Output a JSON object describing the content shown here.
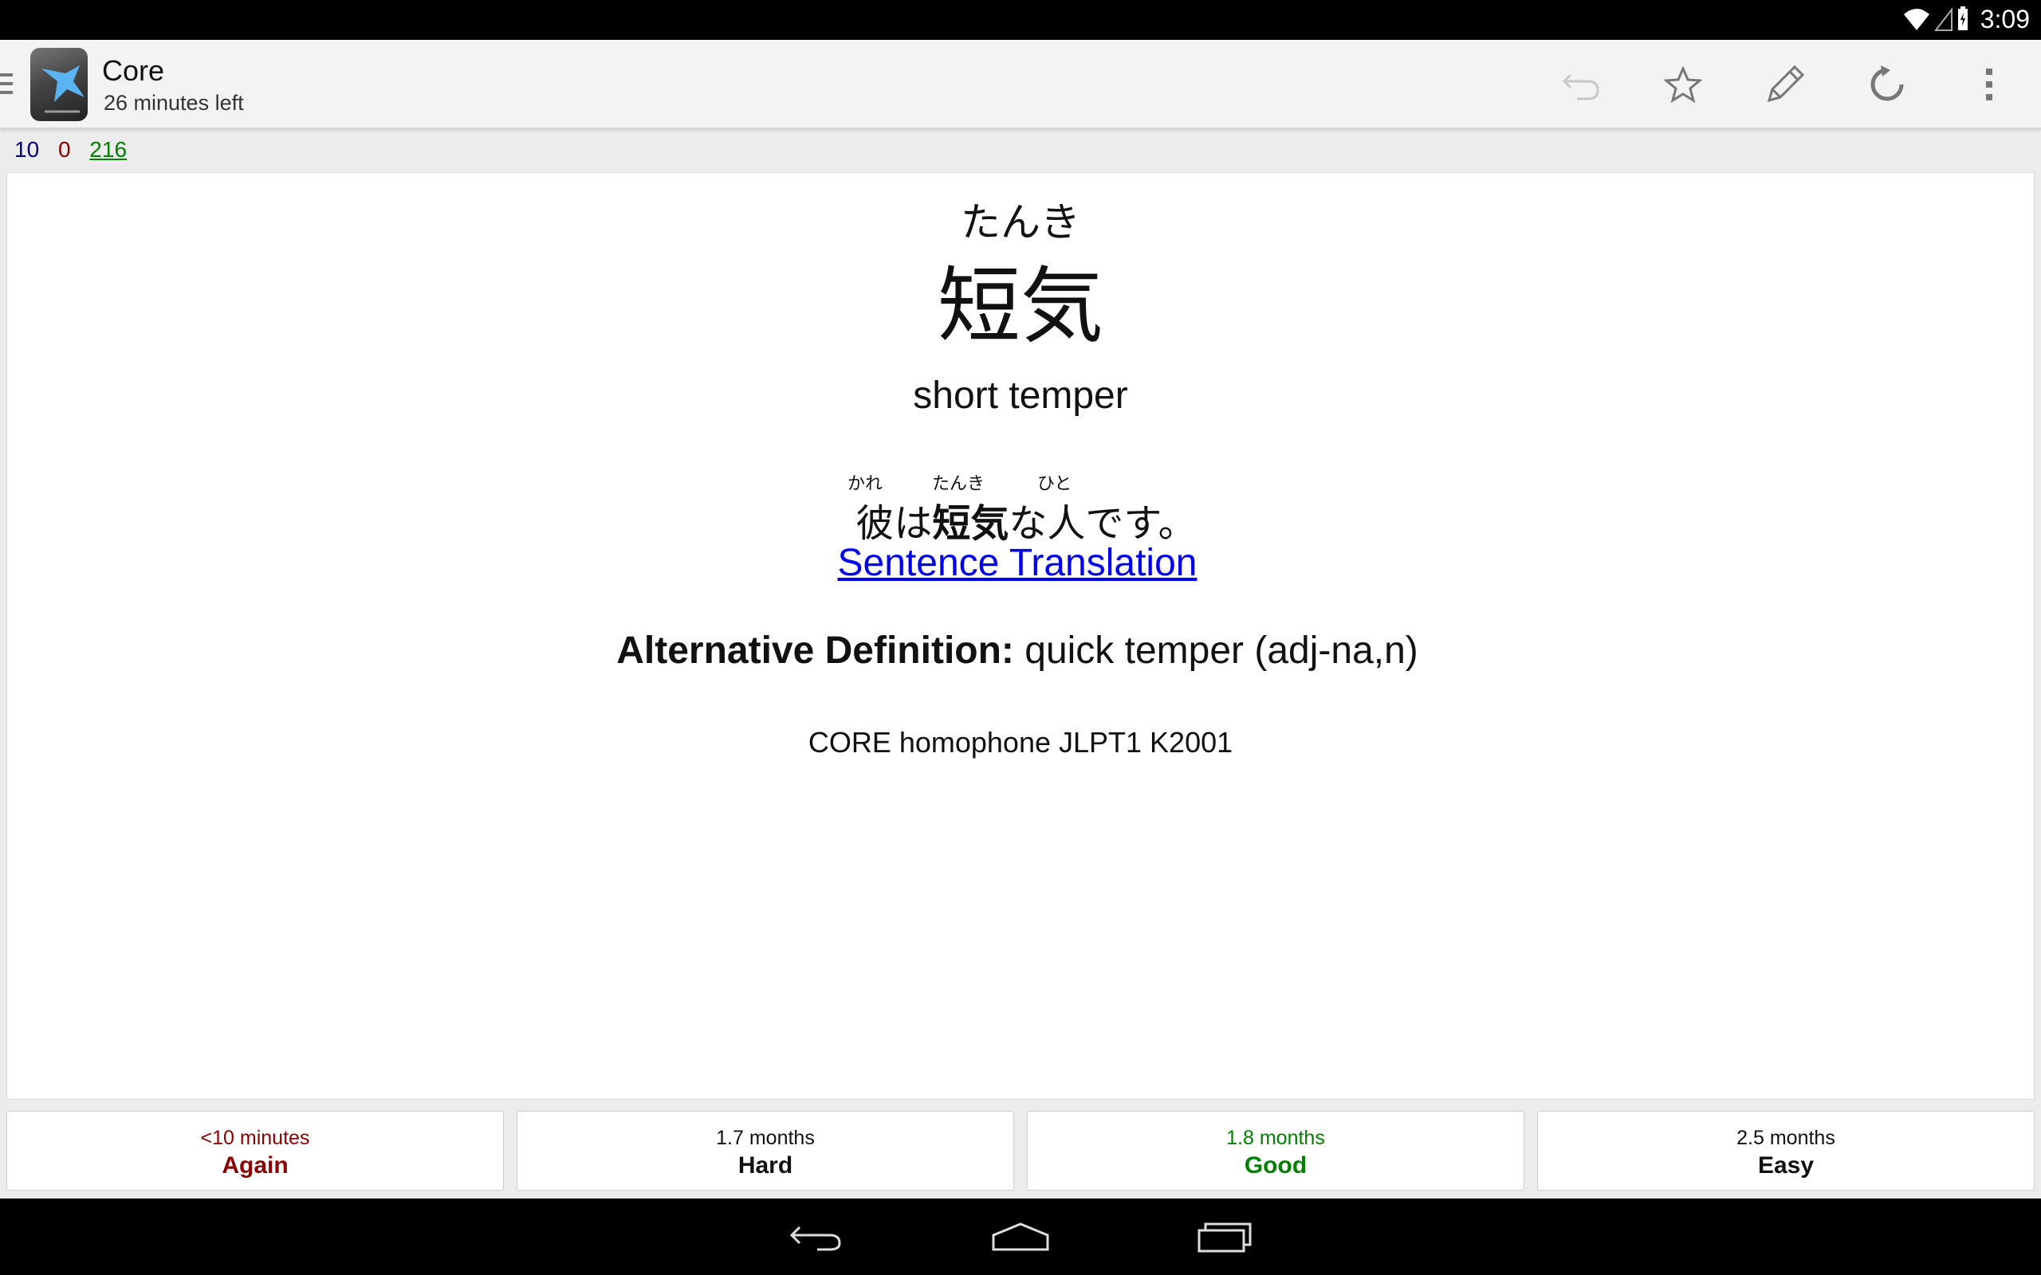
{
  "status": {
    "time": "3:09"
  },
  "actionbar": {
    "title": "Core",
    "subtitle": "26 minutes left",
    "icons": [
      "undo-icon",
      "star-icon",
      "edit-icon",
      "replay-icon",
      "overflow-icon"
    ]
  },
  "counts": {
    "new": "10",
    "learn": "0",
    "review": "216"
  },
  "card": {
    "reading": "たんき",
    "word": "短気",
    "meaning": "short temper",
    "sentence_furigana": [
      "かれ",
      "たんき",
      "ひと"
    ],
    "sentence_parts": [
      "彼は",
      "短気",
      "な人です。"
    ],
    "translation_link": "Sentence Translation",
    "alt_def_label": "Alternative Definition:",
    "alt_def_value": " quick temper (adj-na,n)",
    "tags": "CORE homophone JLPT1 K2001"
  },
  "answers": [
    {
      "interval": "<10 minutes",
      "label": "Again",
      "color": "#8b0000"
    },
    {
      "interval": "1.7 months",
      "label": "Hard",
      "color": "#111111"
    },
    {
      "interval": "1.8 months",
      "label": "Good",
      "color": "#008000"
    },
    {
      "interval": "2.5 months",
      "label": "Easy",
      "color": "#111111"
    }
  ],
  "colors": {
    "new": "#00007f",
    "learn": "#8b0000",
    "review": "#008000",
    "link": "#0000ee"
  }
}
